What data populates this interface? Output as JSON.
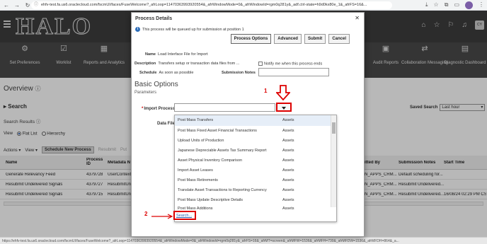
{
  "browser": {
    "url": "ehfv-test.fa.us6.oraclecloud.com/fscmUI/faces/FuseWelcome?_afrLoop=11470363993920554&_afrWindowMode=0&_afrWindowId=rgm0q281y&_adf.ctrl-state=h9d0kx80e_1&_afrFS=16&...",
    "icons": [
      "back-icon",
      "forward-icon",
      "reload-icon",
      "info-icon",
      "download-icon",
      "star-icon",
      "extensions-icon",
      "profile-icon",
      "menu-icon"
    ]
  },
  "header": {
    "logo": "HALO",
    "avatar": "CY",
    "icons": [
      "home-icon",
      "star-icon",
      "flag-icon",
      "bell-icon"
    ]
  },
  "nav": [
    {
      "label": "Set Preferences",
      "icon": "preferences-icon"
    },
    {
      "label": "Worklist",
      "icon": "checklist-icon"
    },
    {
      "label": "Reports and Analytics",
      "icon": "reports-icon"
    },
    {
      "label": "Audit Reports",
      "icon": "audit-icon"
    },
    {
      "label": "Collaboration Messaging",
      "icon": "collaboration-icon"
    },
    {
      "label": "Diagnostic Dashboard",
      "icon": "dashboard-icon"
    }
  ],
  "overview": {
    "title": "Overview",
    "search": "Search",
    "search_results": "Search Results",
    "saved_search_label": "Saved Search",
    "saved_search_value": "Last hour",
    "view_label": "View",
    "flat_list": "Flat List",
    "hierarchy": "Hierarchy",
    "actions": "Actions",
    "view_menu": "View",
    "schedule_new": "Schedule New Process",
    "resubmit": "Resubmit",
    "put": "Put"
  },
  "table": {
    "headers": [
      "Name",
      "Process ID",
      "Metadata N",
      "itted By",
      "Submission Notes",
      "Start Time"
    ],
    "rows": [
      {
        "name": "Generate Relevancy Feed",
        "id": "4379728",
        "meta": "UserContext",
        "by": "N_APPS_CRM...",
        "notes": "Default scheduling for...",
        "start": ""
      },
      {
        "name": "Resubmit Undelivered Signals",
        "id": "4379727",
        "meta": "ResubmitUnd",
        "by": "N_APPS_CRM...",
        "notes": "Resubmit Undelivered...",
        "start": ""
      },
      {
        "name": "Resubmit Undelivered Signals",
        "id": "4379715",
        "meta": "ResubmitUnd",
        "by": "N_APPS_CRM...",
        "notes": "Resubmit Undelivered...",
        "start": "16/08/24 02:29 PM CS"
      }
    ]
  },
  "dialog": {
    "title": "Process Details",
    "info": "This process will be queued up for submission at position 1",
    "btn_options": "Process Options",
    "btn_advanced": "Advanced",
    "btn_submit": "Submit",
    "btn_cancel": "Cancel",
    "name_label": "Name",
    "name_value": "Load Interface File for Import",
    "desc_label": "Description",
    "desc_value": "Transfers setup or transaction data files from ...",
    "notify_label": "Notify me when this process ends",
    "schedule_label": "Schedule",
    "schedule_value": "As soon as possible",
    "notes_label": "Submission Notes",
    "basic_options": "Basic Options",
    "parameters": "Parameters",
    "import_process_label": "Import Process",
    "required_mark": "*",
    "data_file_label": "Data File"
  },
  "dropdown": {
    "items": [
      {
        "name": "Post Mass Transfers",
        "category": "Assets"
      },
      {
        "name": "Post Mass Fixed Asset Financial Transactions",
        "category": "Assets"
      },
      {
        "name": "Upload Units of Production",
        "category": "Assets"
      },
      {
        "name": "Japanese Depreciable Assets Tax Summary Report",
        "category": "Assets"
      },
      {
        "name": "Asset Physical Inventory Comparison",
        "category": "Assets"
      },
      {
        "name": "Import Asset Leases",
        "category": "Assets"
      },
      {
        "name": "Post Mass Retirements",
        "category": "Assets"
      },
      {
        "name": "Translate Asset Transactions to Reporting Currency",
        "category": "Assets"
      },
      {
        "name": "Post Mass Update Descriptive Details",
        "category": "Assets"
      },
      {
        "name": "Post Mass Additions",
        "category": "Assets"
      }
    ],
    "search_link": "Search..."
  },
  "annotations": {
    "one": "1",
    "two": "2"
  },
  "status_bar": "https://ehfv-test.fa.us6.oraclecloud.com/fscmUI/faces/FuseWelcome?_afrLoop=11470363993920554&_afrWindowMode=0&_afrWindowId=rgm0q281y&_afrFS=16&_afrMT=screen&_afrMFW=1536&_afrMFH=730&_afrMFDW=1536&_afrMFDH=864&_a..."
}
